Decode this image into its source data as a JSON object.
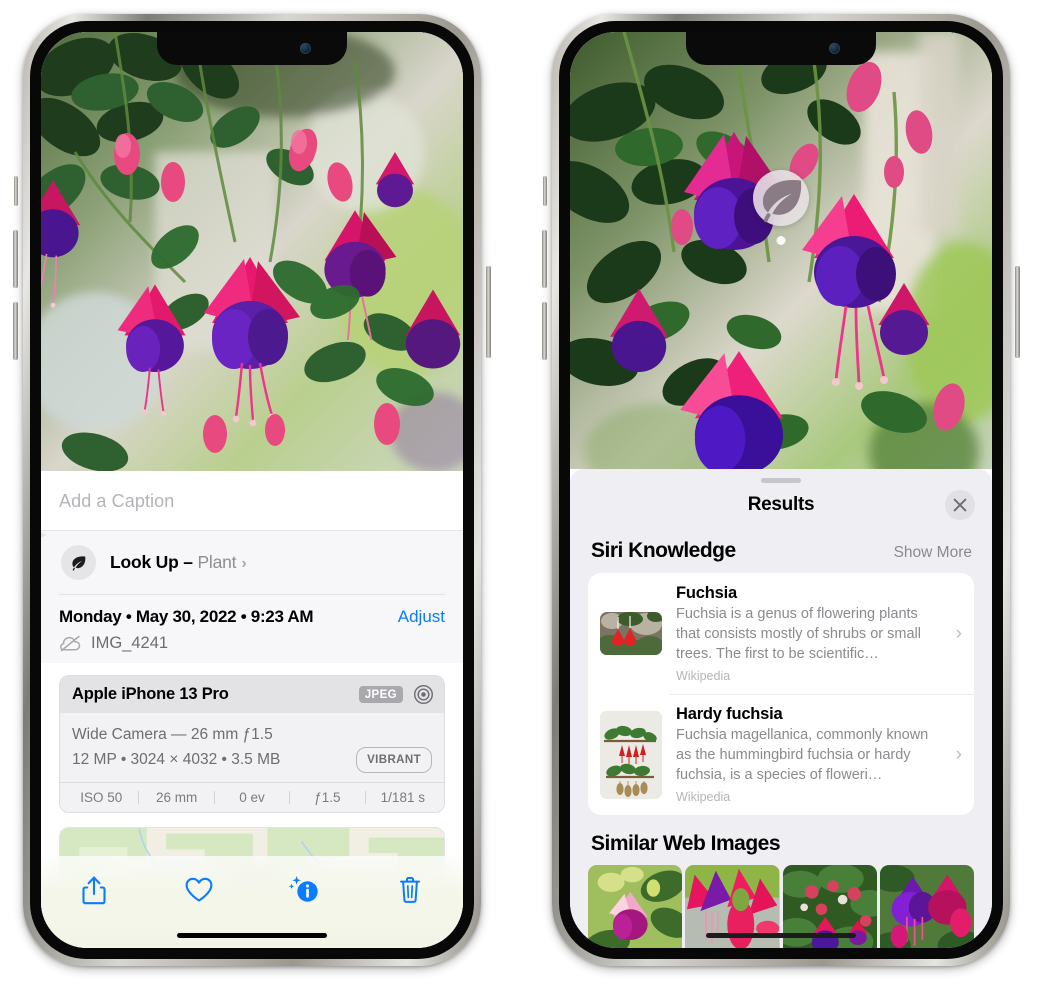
{
  "left_phone": {
    "caption_placeholder": "Add a Caption",
    "lookup": {
      "label": "Look Up",
      "dash": " – ",
      "subject": "Plant",
      "chevron": "›",
      "icon": "leaf-icon"
    },
    "meta": {
      "date": "Monday • May 30, 2022 • 9:23 AM",
      "adjust_label": "Adjust",
      "filename": "IMG_4241",
      "cloud_icon": "icloud-slash-icon"
    },
    "camera": {
      "device": "Apple iPhone 13 Pro",
      "format_chip": "JPEG",
      "raw_icon": "raw-circle-icon",
      "lens_line": "Wide Camera — 26 mm ƒ1.5",
      "specs_line": "12 MP • 3024 × 4032 • 3.5 MB",
      "style_chip": "VIBRANT",
      "exif": [
        "ISO 50",
        "26 mm",
        "0 ev",
        "ƒ1.5",
        "1/181 s"
      ]
    },
    "toolbar": [
      {
        "name": "share-button",
        "icon": "share-icon"
      },
      {
        "name": "favorite-button",
        "icon": "heart-icon"
      },
      {
        "name": "info-button",
        "icon": "info-sparkle-icon",
        "active": true
      },
      {
        "name": "delete-button",
        "icon": "trash-icon"
      }
    ],
    "accent_color": "#0a7cff"
  },
  "right_phone": {
    "photo_badge": {
      "icon": "leaf-icon",
      "name": "visual-lookup-badge"
    },
    "sheet": {
      "title": "Results",
      "close_icon": "close-icon",
      "sections": [
        {
          "title": "Siri Knowledge",
          "action_label": "Show More",
          "items": [
            {
              "title": "Fuchsia",
              "description": "Fuchsia is a genus of flowering plants that consists mostly of shrubs or small trees. The first to be scientific…",
              "source": "Wikipedia",
              "chevron": "›",
              "thumb": "fuchsia-red-flowers-thumb"
            },
            {
              "title": "Hardy fuchsia",
              "description": "Fuchsia magellanica, commonly known as the hummingbird fuchsia or hardy fuchsia, is a species of floweri…",
              "source": "Wikipedia",
              "chevron": "›",
              "thumb": "hardy-fuchsia-specimen-thumb"
            }
          ]
        },
        {
          "title": "Similar Web Images",
          "images": [
            "fuchsia-pink-purple-leaves",
            "fuchsia-red-closeup",
            "fuchsia-bush-buds",
            "fuchsia-purple-magenta-cluster"
          ]
        }
      ]
    }
  }
}
